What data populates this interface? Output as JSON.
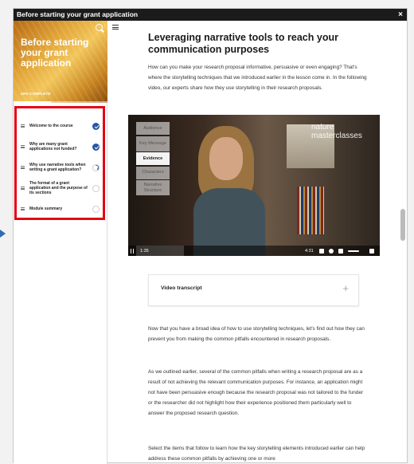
{
  "window": {
    "title": "Before starting your grant application",
    "close_label": "×"
  },
  "sidebar": {
    "hero_title": "Before starting your grant application",
    "progress_text": "40% COMPLETE",
    "progress_fraction": 0.4,
    "modules": [
      {
        "label": "Welcome to the course",
        "status": "done"
      },
      {
        "label": "Why are many grant applications not funded?",
        "status": "done"
      },
      {
        "label": "Why use narrative tools when writing a grant application?",
        "status": "partial"
      },
      {
        "label": "The format of a grant application and the purpose of its sections",
        "status": "empty"
      },
      {
        "label": "Module summary",
        "status": "empty"
      }
    ]
  },
  "main": {
    "heading": "Leveraging narrative tools to reach your communication purposes",
    "intro": "How can you make your research proposal informative, persuasive or even engaging? That's where the storytelling techniques that we introduced earlier in the lesson come in. In the following video, our experts share how they use storytelling in their research proposals.",
    "video": {
      "logo": "nature masterclasses",
      "tags": [
        "Audience",
        "Key Message",
        "Evidence",
        "Characters",
        "Narrative Structure"
      ],
      "active_tag": "Evidence",
      "current_time": "1:35",
      "duration": "4:31"
    },
    "transcript_label": "Video transcript",
    "transcript_toggle": "+",
    "para2": "Now that you have a broad idea of how to use storytelling techniques, let's find out how they can prevent you from making the common pitfalls encountered in research proposals.",
    "para3": "As we outlined earlier, several of the common pitfalls when writing a research proposal are as a result of not achieving the relevant communication purposes. For instance, an application might not have been persuasive enough because the research proposal was not tailored to the funder or the researcher did not highlight how their experience positioned them particularly well to answer the proposed research question.",
    "para4": "Select the items that follow to learn how the key storytelling elements introduced earlier can help address these common pitfalls by achieving one or more"
  },
  "colors": {
    "accent": "#2755a5",
    "highlight_box": "#e30613",
    "titlebar": "#1b1b1b"
  },
  "icons": [
    "search-icon",
    "menu-icon",
    "check-icon",
    "close-icon",
    "plus-icon",
    "play-icon",
    "arrow-right-icon"
  ]
}
